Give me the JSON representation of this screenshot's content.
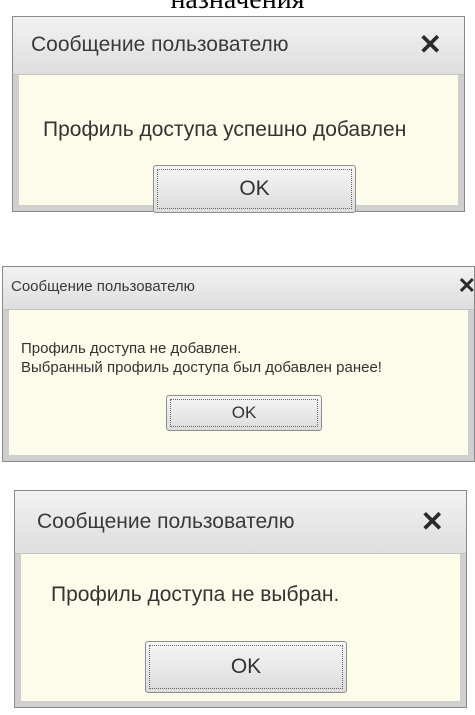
{
  "header_text": "назначения",
  "dialogs": [
    {
      "title": "Сообщение пользователю",
      "close_glyph": "✕",
      "message": "Профиль доступа успешно добавлен",
      "ok_label": "OK"
    },
    {
      "title": "Сообщение пользователю",
      "close_glyph": "✕",
      "message_lines": [
        "Профиль доступа не добавлен.",
        "Выбранный профиль доступа был добавлен ранее!"
      ],
      "ok_label": "OK"
    },
    {
      "title": "Сообщение пользователю",
      "close_glyph": "✕",
      "message": "Профиль доступа не выбран.",
      "ok_label": "OK"
    }
  ],
  "colors": {
    "dialog_background": "#fdfbe9",
    "titlebar_top": "#f2f2f2",
    "titlebar_bottom": "#dedede",
    "frame": "#cfcfcf"
  }
}
